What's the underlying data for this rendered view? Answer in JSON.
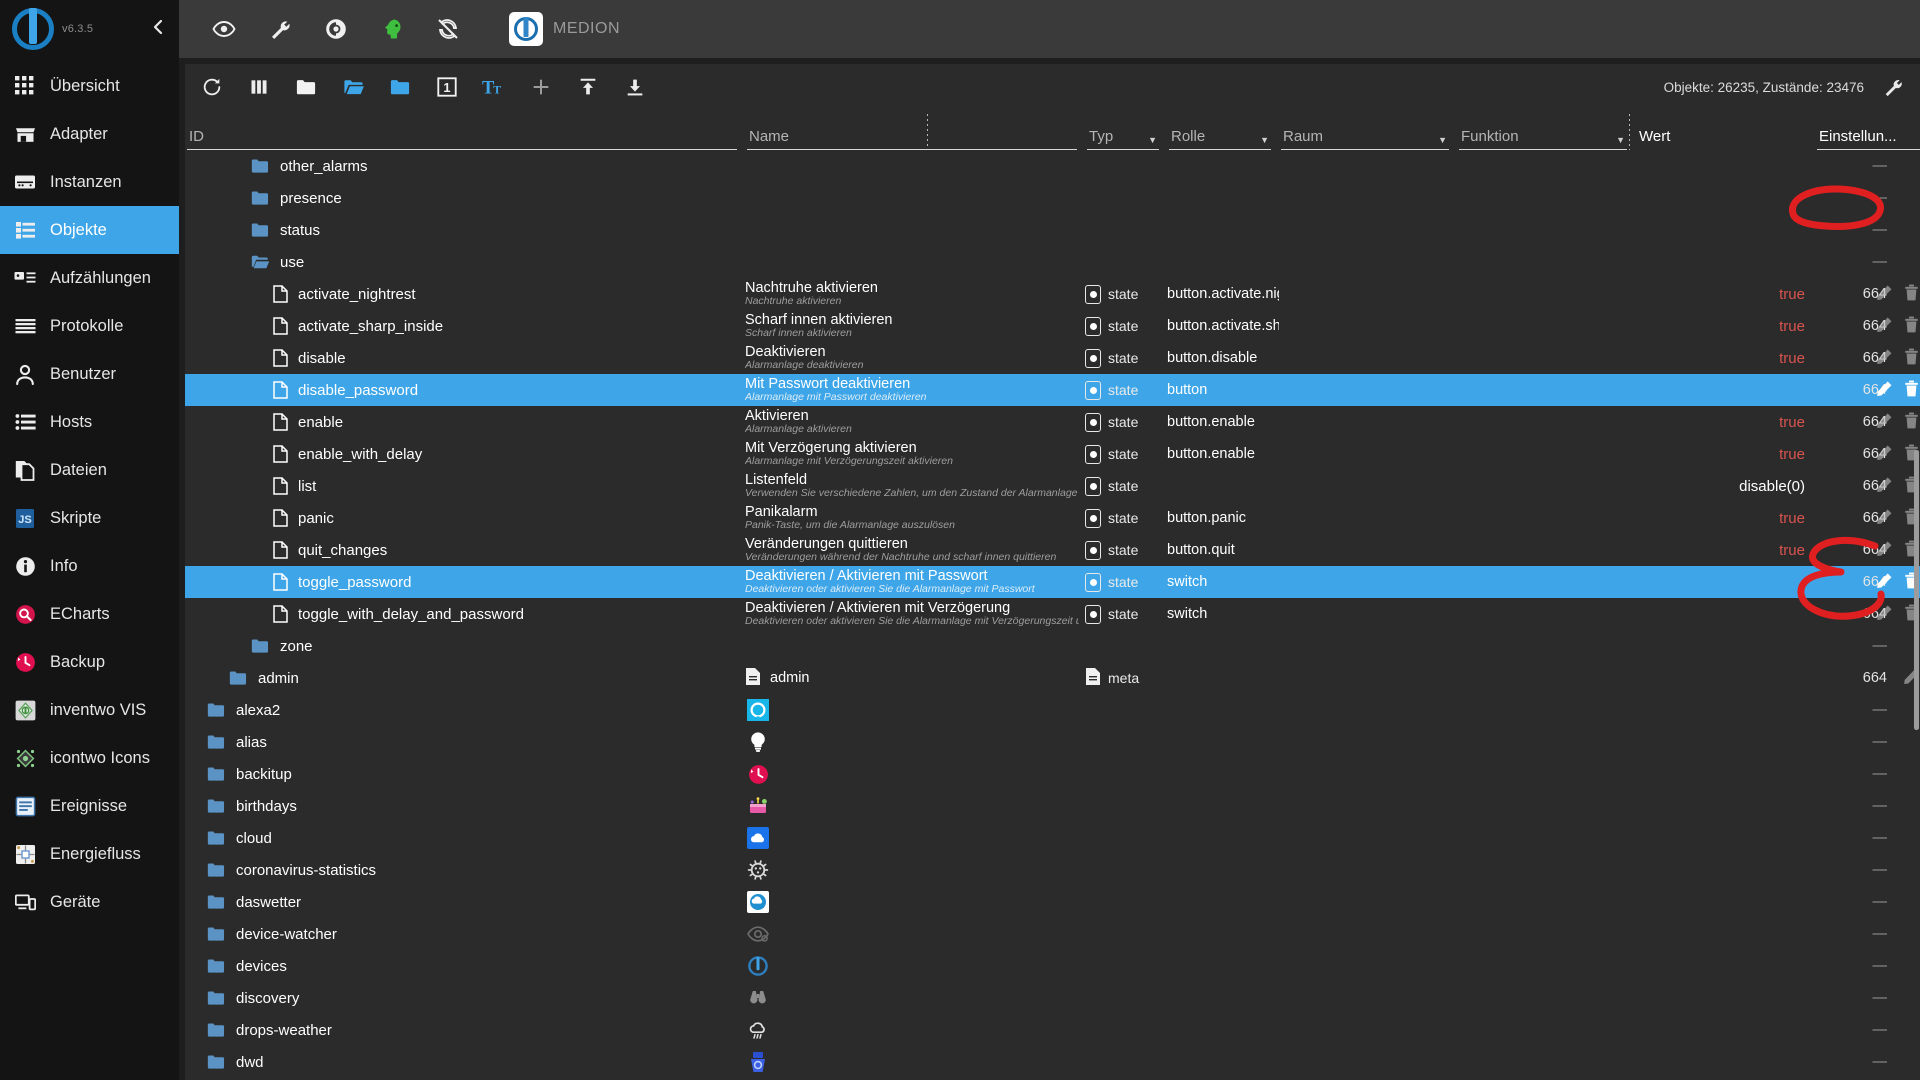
{
  "sidebar": {
    "version": "v6.3.5",
    "collapse_label": "‹",
    "items": [
      {
        "label": "Übersicht",
        "icon": "grid-icon",
        "active": false
      },
      {
        "label": "Adapter",
        "icon": "store-icon",
        "active": false
      },
      {
        "label": "Instanzen",
        "icon": "instances-icon",
        "active": false
      },
      {
        "label": "Objekte",
        "icon": "list-icon",
        "active": true
      },
      {
        "label": "Aufzählungen",
        "icon": "enum-icon",
        "active": false
      },
      {
        "label": "Protokolle",
        "icon": "log-icon",
        "active": false
      },
      {
        "label": "Benutzer",
        "icon": "user-icon",
        "active": false
      },
      {
        "label": "Hosts",
        "icon": "hosts-icon",
        "active": false
      },
      {
        "label": "Dateien",
        "icon": "files-icon",
        "active": false
      },
      {
        "label": "Skripte",
        "icon": "js-icon",
        "active": false
      },
      {
        "label": "Info",
        "icon": "info-icon",
        "active": false
      },
      {
        "label": "ECharts",
        "icon": "echarts-icon",
        "active": false
      },
      {
        "label": "Backup",
        "icon": "backup-icon",
        "active": false
      },
      {
        "label": "inventwo VIS",
        "icon": "inventwo-icon",
        "active": false
      },
      {
        "label": "icontwo Icons",
        "icon": "icontwo-icon",
        "active": false
      },
      {
        "label": "Ereignisse",
        "icon": "events-icon",
        "active": false
      },
      {
        "label": "Energiefluss",
        "icon": "energyflow-icon",
        "active": false
      },
      {
        "label": "Geräte",
        "icon": "devices-icon",
        "active": false
      }
    ]
  },
  "topbar": {
    "icons": [
      "eye-icon",
      "wrench-icon",
      "contrast-icon",
      "head-green-icon",
      "sync-off-icon"
    ],
    "host_name": "MEDION",
    "host_icon": "iobroker-logo-icon"
  },
  "toolbar": {
    "icons": [
      "refresh-icon",
      "columns-icon",
      "folder-white-icon",
      "folder-open-blue-icon",
      "folder-blue-icon",
      "depth-1-icon",
      "text-size-icon",
      "plus-icon",
      "upload-icon",
      "download-icon"
    ],
    "depth_badge": "1",
    "stats": "Objekte: 26235, Zustände: 23476",
    "settings_icon": "wrench-icon"
  },
  "columns": [
    {
      "key": "id",
      "label": "ID",
      "filter": false
    },
    {
      "key": "name",
      "label": "Name",
      "filter": false
    },
    {
      "key": "typ",
      "label": "Typ",
      "filter": true
    },
    {
      "key": "role",
      "label": "Rolle",
      "filter": true
    },
    {
      "key": "room",
      "label": "Raum",
      "filter": true
    },
    {
      "key": "func",
      "label": "Funktion",
      "filter": true
    },
    {
      "key": "value",
      "label": "Wert",
      "filter": false
    },
    {
      "key": "settings",
      "label": "Einstellun...",
      "filter": true
    }
  ],
  "rows": [
    {
      "id": "other_alarms",
      "kind": "folder",
      "indent": 2,
      "name": "",
      "sub": "",
      "typ": "",
      "role": "",
      "value": "",
      "value_kind": "",
      "settings": "—",
      "actions": [
        "delete"
      ],
      "selected": false
    },
    {
      "id": "presence",
      "kind": "folder",
      "indent": 2,
      "name": "",
      "sub": "",
      "typ": "",
      "role": "",
      "value": "",
      "value_kind": "",
      "settings": "—",
      "actions": [
        "delete"
      ],
      "selected": false
    },
    {
      "id": "status",
      "kind": "folder",
      "indent": 2,
      "name": "",
      "sub": "",
      "typ": "",
      "role": "",
      "value": "",
      "value_kind": "",
      "settings": "—",
      "actions": [
        "delete"
      ],
      "selected": false
    },
    {
      "id": "use",
      "kind": "folder-open",
      "indent": 2,
      "name": "",
      "sub": "",
      "typ": "",
      "role": "",
      "value": "",
      "value_kind": "",
      "settings": "—",
      "actions": [
        "delete"
      ],
      "selected": false
    },
    {
      "id": "activate_nightrest",
      "kind": "file",
      "indent": 3,
      "name": "Nachtruhe aktivieren",
      "sub": "Nachtruhe aktivieren",
      "typ": "state",
      "role": "button.activate.night...",
      "value": "true",
      "value_kind": "true",
      "settings": "664",
      "actions": [
        "edit",
        "delete",
        "gear"
      ],
      "selected": false
    },
    {
      "id": "activate_sharp_inside",
      "kind": "file",
      "indent": 3,
      "name": "Scharf innen aktivieren",
      "sub": "Scharf innen aktivieren",
      "typ": "state",
      "role": "button.activate.sharp...",
      "value": "true",
      "value_kind": "true",
      "settings": "664",
      "actions": [
        "edit",
        "delete",
        "gear"
      ],
      "selected": false
    },
    {
      "id": "disable",
      "kind": "file",
      "indent": 3,
      "name": "Deaktivieren",
      "sub": "Alarmanlage deaktivieren",
      "typ": "state",
      "role": "button.disable",
      "value": "true",
      "value_kind": "true",
      "settings": "664",
      "actions": [
        "edit",
        "delete",
        "gear"
      ],
      "selected": false
    },
    {
      "id": "disable_password",
      "kind": "file",
      "indent": 3,
      "name": "Mit Passwort deaktivieren",
      "sub": "Alarmanlage mit Passwort deaktivieren",
      "typ": "state",
      "role": "button",
      "value": "",
      "value_kind": "",
      "settings": "664",
      "actions": [
        "edit",
        "delete",
        "gear"
      ],
      "selected": true
    },
    {
      "id": "enable",
      "kind": "file",
      "indent": 3,
      "name": "Aktivieren",
      "sub": "Alarmanlage aktivieren",
      "typ": "state",
      "role": "button.enable",
      "value": "true",
      "value_kind": "true",
      "settings": "664",
      "actions": [
        "edit",
        "delete",
        "gear"
      ],
      "selected": false
    },
    {
      "id": "enable_with_delay",
      "kind": "file",
      "indent": 3,
      "name": "Mit Verzögerung aktivieren",
      "sub": "Alarmanlage mit Verzögerungszeit aktivieren",
      "typ": "state",
      "role": "button.enable",
      "value": "true",
      "value_kind": "true",
      "settings": "664",
      "actions": [
        "edit",
        "delete",
        "gear"
      ],
      "selected": false
    },
    {
      "id": "list",
      "kind": "file",
      "indent": 3,
      "name": "Listenfeld",
      "sub": "Verwenden Sie verschiedene Zahlen, um den Zustand der Alarmanlage zu ä",
      "typ": "state",
      "role": "",
      "value": "disable(0)",
      "value_kind": "plain",
      "settings": "664",
      "actions": [
        "edit",
        "delete",
        "gear"
      ],
      "selected": false
    },
    {
      "id": "panic",
      "kind": "file",
      "indent": 3,
      "name": "Panikalarm",
      "sub": "Panik-Taste, um die Alarmanlage auszulösen",
      "typ": "state",
      "role": "button.panic",
      "value": "true",
      "value_kind": "true",
      "settings": "664",
      "actions": [
        "edit",
        "delete",
        "gear"
      ],
      "selected": false
    },
    {
      "id": "quit_changes",
      "kind": "file",
      "indent": 3,
      "name": "Veränderungen quittieren",
      "sub": "Veränderungen während der Nachtruhe und scharf innen quittieren",
      "typ": "state",
      "role": "button.quit",
      "value": "true",
      "value_kind": "true",
      "settings": "664",
      "actions": [
        "edit",
        "delete",
        "gear"
      ],
      "selected": false
    },
    {
      "id": "toggle_password",
      "kind": "file",
      "indent": 3,
      "name": "Deaktivieren / Aktivieren mit Passwort",
      "sub": "Deaktivieren oder aktivieren Sie die Alarmanlage mit Passwort",
      "typ": "state",
      "role": "switch",
      "value": "",
      "value_kind": "",
      "settings": "664",
      "actions": [
        "edit",
        "delete",
        "gear"
      ],
      "selected": true
    },
    {
      "id": "toggle_with_delay_and_password",
      "kind": "file",
      "indent": 3,
      "name": "Deaktivieren / Aktivieren mit Verzögerung",
      "sub": "Deaktivieren oder aktivieren Sie die Alarmanlage mit Verzögerungszeit und ",
      "typ": "state",
      "role": "switch",
      "value": "",
      "value_kind": "",
      "settings": "664",
      "actions": [
        "edit",
        "delete",
        "gear"
      ],
      "selected": false
    },
    {
      "id": "zone",
      "kind": "folder",
      "indent": 2,
      "name": "",
      "sub": "",
      "typ": "",
      "role": "",
      "value": "",
      "value_kind": "",
      "settings": "—",
      "actions": [
        "delete"
      ],
      "selected": false
    },
    {
      "id": "admin",
      "kind": "folder",
      "indent": 1,
      "name": "admin",
      "sub": "",
      "typ": "meta",
      "role": "",
      "value": "",
      "value_kind": "",
      "settings": "664",
      "actions": [
        "edit",
        "delete"
      ],
      "selected": false,
      "name_icon": "doc-icon",
      "typ_icon": "doc-icon"
    },
    {
      "id": "alexa2",
      "kind": "folder",
      "indent": 0,
      "name": "",
      "sub": "",
      "typ": "",
      "role": "",
      "value": "",
      "value_kind": "",
      "settings": "—",
      "actions": [
        "delete"
      ],
      "selected": false,
      "adapter_icon": "alexa-icon"
    },
    {
      "id": "alias",
      "kind": "folder",
      "indent": 0,
      "name": "",
      "sub": "",
      "typ": "",
      "role": "",
      "value": "",
      "value_kind": "",
      "settings": "—",
      "actions": [
        "delete"
      ],
      "selected": false,
      "adapter_icon": "bulb-icon"
    },
    {
      "id": "backitup",
      "kind": "folder",
      "indent": 0,
      "name": "",
      "sub": "",
      "typ": "",
      "role": "",
      "value": "",
      "value_kind": "",
      "settings": "—",
      "actions": [
        "delete"
      ],
      "selected": false,
      "adapter_icon": "backup-clock-icon"
    },
    {
      "id": "birthdays",
      "kind": "folder",
      "indent": 0,
      "name": "",
      "sub": "",
      "typ": "",
      "role": "",
      "value": "",
      "value_kind": "",
      "settings": "—",
      "actions": [
        "delete"
      ],
      "selected": false,
      "adapter_icon": "birthday-icon"
    },
    {
      "id": "cloud",
      "kind": "folder",
      "indent": 0,
      "name": "",
      "sub": "",
      "typ": "",
      "role": "",
      "value": "",
      "value_kind": "",
      "settings": "—",
      "actions": [
        "delete"
      ],
      "selected": false,
      "adapter_icon": "cloud-icon"
    },
    {
      "id": "coronavirus-statistics",
      "kind": "folder",
      "indent": 0,
      "name": "",
      "sub": "",
      "typ": "",
      "role": "",
      "value": "",
      "value_kind": "",
      "settings": "—",
      "actions": [
        "delete"
      ],
      "selected": false,
      "adapter_icon": "virus-icon"
    },
    {
      "id": "daswetter",
      "kind": "folder",
      "indent": 0,
      "name": "",
      "sub": "",
      "typ": "",
      "role": "",
      "value": "",
      "value_kind": "",
      "settings": "—",
      "actions": [
        "delete"
      ],
      "selected": false,
      "adapter_icon": "daswetter-icon"
    },
    {
      "id": "device-watcher",
      "kind": "folder",
      "indent": 0,
      "name": "",
      "sub": "",
      "typ": "",
      "role": "",
      "value": "",
      "value_kind": "",
      "settings": "—",
      "actions": [
        "delete"
      ],
      "selected": false,
      "adapter_icon": "eye-watch-icon"
    },
    {
      "id": "devices",
      "kind": "folder",
      "indent": 0,
      "name": "",
      "sub": "",
      "typ": "",
      "role": "",
      "value": "",
      "value_kind": "",
      "settings": "—",
      "actions": [
        "delete"
      ],
      "selected": false,
      "adapter_icon": "iobroker-logo-icon"
    },
    {
      "id": "discovery",
      "kind": "folder",
      "indent": 0,
      "name": "",
      "sub": "",
      "typ": "",
      "role": "",
      "value": "",
      "value_kind": "",
      "settings": "—",
      "actions": [
        "delete"
      ],
      "selected": false,
      "adapter_icon": "binoculars-icon"
    },
    {
      "id": "drops-weather",
      "kind": "folder",
      "indent": 0,
      "name": "",
      "sub": "",
      "typ": "",
      "role": "",
      "value": "",
      "value_kind": "",
      "settings": "—",
      "actions": [
        "delete"
      ],
      "selected": false,
      "adapter_icon": "rain-cloud-icon"
    },
    {
      "id": "dwd",
      "kind": "folder",
      "indent": 0,
      "name": "",
      "sub": "",
      "typ": "",
      "role": "",
      "value": "",
      "value_kind": "",
      "settings": "—",
      "actions": [
        "delete"
      ],
      "selected": false,
      "adapter_icon": "dwd-icon"
    }
  ],
  "annotations": {
    "color": "#e02020",
    "shapes": [
      "circle-over-disable-password-value",
      "circle-over-toggle-password-value"
    ]
  },
  "colors": {
    "accent": "#3ea6e8",
    "sidebar_bg": "#141414",
    "panel_bg": "#2b2b2b",
    "topbar_bg": "#3a3a3a",
    "true_value": "#d9534f",
    "annotation_red": "#e02020"
  }
}
